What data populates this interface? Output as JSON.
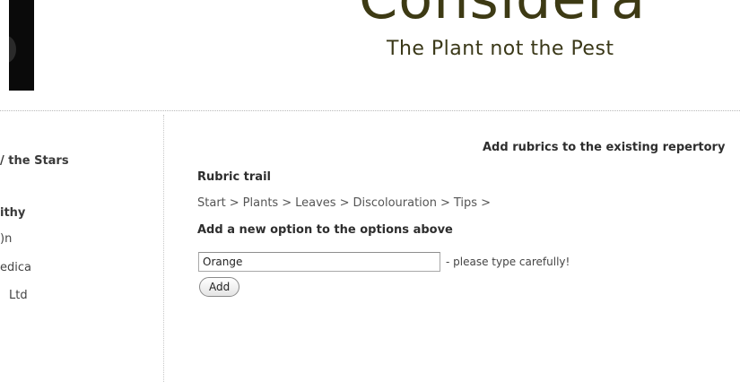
{
  "header": {
    "brand_name": "Considera",
    "tagline": "The Plant not the Pest"
  },
  "sidebar": {
    "items": [
      {
        "label": "/ the Stars",
        "bold": true
      },
      {
        "label": "ithy",
        "bold": true
      },
      {
        "label": ")n",
        "bold": false
      },
      {
        "label": "edica",
        "bold": false
      },
      {
        "label": "Ltd",
        "bold": false
      }
    ]
  },
  "main": {
    "section_title": "Add rubrics to the existing repertory",
    "trail_heading": "Rubric trail",
    "breadcrumb": [
      "Start",
      "Plants",
      "Leaves",
      "Discolouration",
      "Tips"
    ],
    "breadcrumb_separator": ">",
    "add_heading": "Add a new option to the options above",
    "option_input": {
      "value": "Orange"
    },
    "hint": "- please type carefully!",
    "add_button_label": "Add"
  }
}
